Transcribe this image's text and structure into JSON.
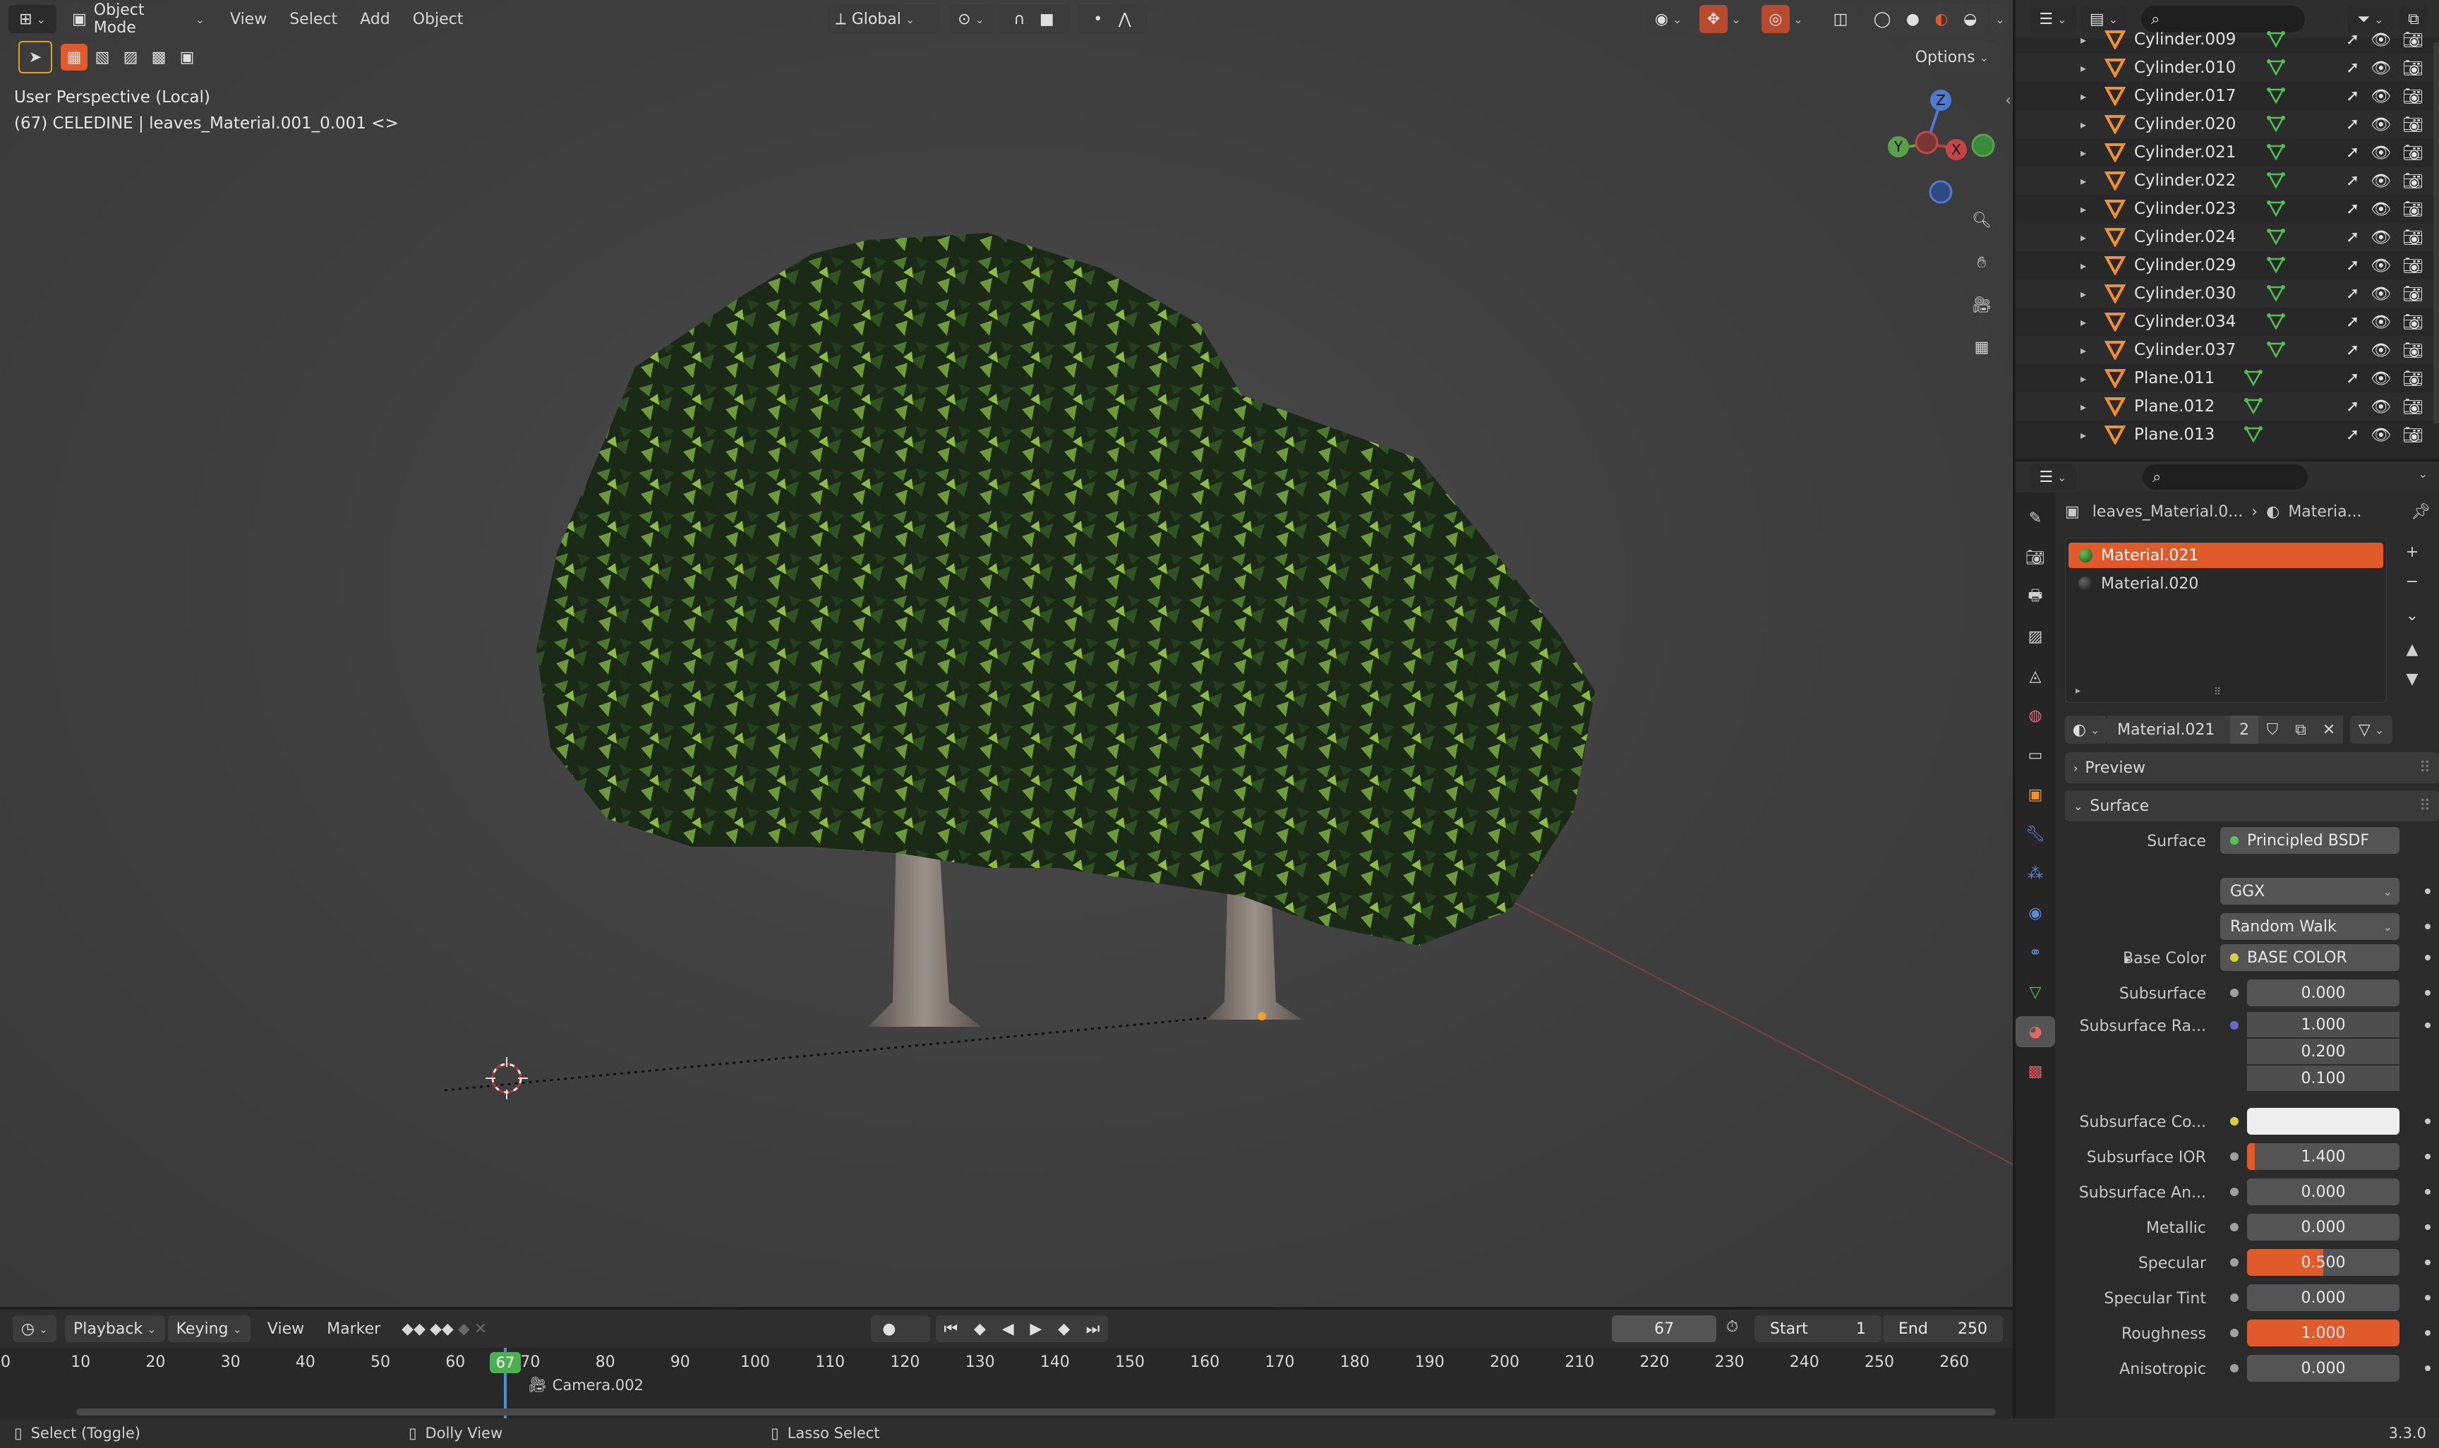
{
  "viewport": {
    "mode_label": "Object Mode",
    "menus": [
      "View",
      "Select",
      "Add",
      "Object"
    ],
    "transform_orientation": "Global",
    "info_line1": "User Perspective (Local)",
    "info_line2": "(67) CELEDINE | leaves_Material.001_0.001 <>",
    "options_label": "Options",
    "gizmo_labels": {
      "z": "Z",
      "y": "Y",
      "x": "X"
    }
  },
  "outliner": {
    "items": [
      {
        "name": "Cylinder.009"
      },
      {
        "name": "Cylinder.010"
      },
      {
        "name": "Cylinder.017"
      },
      {
        "name": "Cylinder.020"
      },
      {
        "name": "Cylinder.021"
      },
      {
        "name": "Cylinder.022"
      },
      {
        "name": "Cylinder.023"
      },
      {
        "name": "Cylinder.024"
      },
      {
        "name": "Cylinder.029"
      },
      {
        "name": "Cylinder.030"
      },
      {
        "name": "Cylinder.034"
      },
      {
        "name": "Cylinder.037"
      },
      {
        "name": "Plane.011"
      },
      {
        "name": "Plane.012"
      },
      {
        "name": "Plane.013"
      }
    ]
  },
  "properties": {
    "breadcrumb_object": "leaves_Material.0...",
    "breadcrumb_material": "Materia...",
    "material_slots": [
      "Material.021",
      "Material.020"
    ],
    "material_name": "Material.021",
    "material_users": "2",
    "panel_preview": "Preview",
    "panel_surface": "Surface",
    "surface_label": "Surface",
    "surface_value": "Principled BSDF",
    "distribution": "GGX",
    "subsurface_method": "Random Walk",
    "fields": {
      "base_color_label": "Base Color",
      "base_color_value": "BASE COLOR",
      "subsurface_label": "Subsurface",
      "subsurface_value": "0.000",
      "subsurface_radius_label": "Subsurface Ra...",
      "subsurface_radius_x": "1.000",
      "subsurface_radius_y": "0.200",
      "subsurface_radius_z": "0.100",
      "subsurface_color_label": "Subsurface Co...",
      "subsurface_ior_label": "Subsurface IOR",
      "subsurface_ior_value": "1.400",
      "subsurface_aniso_label": "Subsurface An...",
      "subsurface_aniso_value": "0.000",
      "metallic_label": "Metallic",
      "metallic_value": "0.000",
      "specular_label": "Specular",
      "specular_value": "0.500",
      "specular_tint_label": "Specular Tint",
      "specular_tint_value": "0.000",
      "roughness_label": "Roughness",
      "roughness_value": "1.000",
      "anisotropic_label": "Anisotropic",
      "anisotropic_value": "0.000"
    },
    "sliders": {
      "subsurface_ior": 0.05,
      "specular": 0.5,
      "roughness": 1.0
    },
    "colors": {
      "accent": "#e05a2b",
      "selected_slot": "#e15a2b",
      "field": "#545454"
    }
  },
  "timeline": {
    "menus": [
      "Playback",
      "Keying",
      "View",
      "Marker"
    ],
    "current_frame": "67",
    "start_label": "Start",
    "start_value": "1",
    "end_label": "End",
    "end_value": "250",
    "ruler_ticks": [
      "0",
      "10",
      "20",
      "30",
      "40",
      "50",
      "60",
      "70",
      "80",
      "90",
      "100",
      "110",
      "120",
      "130",
      "140",
      "150",
      "160",
      "170",
      "180",
      "190",
      "200",
      "210",
      "220",
      "230",
      "240",
      "250",
      "260"
    ],
    "camera_marker": "Camera.002"
  },
  "statusbar": {
    "hint1": "Select (Toggle)",
    "hint2": "Dolly View",
    "hint3": "Lasso Select",
    "version": "3.3.0"
  }
}
